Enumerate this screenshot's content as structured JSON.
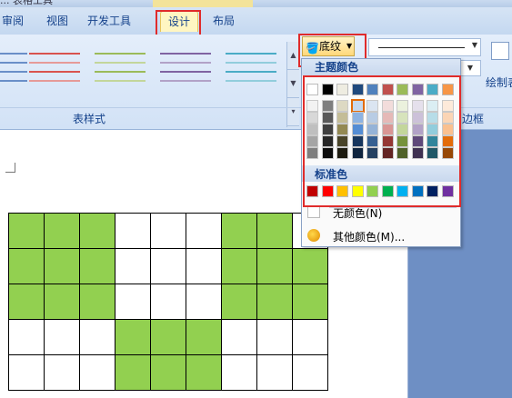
{
  "title_fragment": "... 表格工具",
  "tabs": [
    {
      "label": "审阅",
      "active": false
    },
    {
      "label": "视图",
      "active": false
    },
    {
      "label": "开发工具",
      "active": false
    },
    {
      "label": "设计",
      "active": true
    },
    {
      "label": "布局",
      "active": false
    }
  ],
  "ribbon": {
    "table_styles_group_label": "表样式",
    "borders_group_label": "边框",
    "shading_button_label": "底纹",
    "draw_table_label": "绘制表"
  },
  "shading_menu": {
    "theme_colors_header": "主题颜色",
    "standard_colors_header": "标准色",
    "no_color_label": "无颜色(N)",
    "more_colors_label": "其他颜色(M)...",
    "theme_colors": [
      "#ffffff",
      "#000000",
      "#eeece1",
      "#1f497d",
      "#4f81bd",
      "#c0504d",
      "#9bbb59",
      "#8064a2",
      "#4bacc6",
      "#f79646"
    ],
    "theme_shades": [
      [
        "#f2f2f2",
        "#d8d8d8",
        "#bfbfbf",
        "#a5a5a5",
        "#7f7f7f"
      ],
      [
        "#7f7f7f",
        "#595959",
        "#3f3f3f",
        "#262626",
        "#0c0c0c"
      ],
      [
        "#ddd9c3",
        "#c4bd97",
        "#938953",
        "#494429",
        "#1d1b10"
      ],
      [
        "#c6d9f0",
        "#8db3e2",
        "#548dd4",
        "#17365d",
        "#0f243e"
      ],
      [
        "#dbe5f1",
        "#b8cce4",
        "#95b3d7",
        "#366092",
        "#244061"
      ],
      [
        "#f2dcdb",
        "#e5b9b7",
        "#d99694",
        "#953734",
        "#632423"
      ],
      [
        "#ebf1dd",
        "#d7e3bc",
        "#c3d69b",
        "#76923c",
        "#4f6128"
      ],
      [
        "#e5e0ec",
        "#ccc1d9",
        "#b2a2c7",
        "#5f497a",
        "#3f3151"
      ],
      [
        "#dbeef3",
        "#b7dde8",
        "#92cddc",
        "#31859b",
        "#205867"
      ],
      [
        "#fdeada",
        "#fbd5b5",
        "#fac08f",
        "#e36c09",
        "#974806"
      ]
    ],
    "selected_swatch": "#c6d9f0",
    "standard_colors": [
      "#c00000",
      "#ff0000",
      "#ffc000",
      "#ffff00",
      "#92d050",
      "#00b050",
      "#00b0f0",
      "#0070c0",
      "#002060",
      "#7030a0"
    ]
  },
  "document": {
    "cell_fill_color": "#92d050",
    "table_pattern": [
      [
        1,
        1,
        1,
        0,
        0,
        0,
        1,
        1,
        0
      ],
      [
        1,
        1,
        1,
        0,
        0,
        0,
        1,
        1,
        1
      ],
      [
        1,
        1,
        1,
        0,
        0,
        0,
        1,
        1,
        1
      ],
      [
        0,
        0,
        0,
        1,
        1,
        1,
        0,
        0,
        0
      ],
      [
        0,
        0,
        0,
        1,
        1,
        1,
        0,
        0,
        0
      ]
    ]
  }
}
